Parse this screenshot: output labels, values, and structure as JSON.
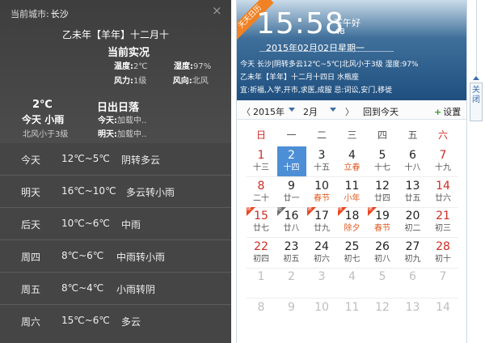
{
  "weather": {
    "city_label": "当前城市:",
    "city_name": "长沙",
    "close_icon": "×",
    "lunar_date": "乙未年【羊年】十二月十",
    "current": {
      "title": "当前实况",
      "temp_label": "温度:",
      "temp_value": "2℃",
      "humidity_label": "湿度:",
      "humidity_value": "97%",
      "wind_label": "风力:",
      "wind_value": "1级",
      "dir_label": "风向:",
      "dir_value": "北风"
    },
    "today": {
      "temp": "2℃",
      "day": "今天",
      "cond": "小雨",
      "wind": "北风小于3级"
    },
    "sun": {
      "title": "日出日落",
      "today_label": "今天:",
      "today_value": "加载中..",
      "tomorrow_label": "明天:",
      "tomorrow_value": "加载中.."
    },
    "forecast": [
      {
        "day": "今天",
        "temp": "12℃~5℃",
        "cond": "阴转多云"
      },
      {
        "day": "明天",
        "temp": "16℃~10℃",
        "cond": "多云转小雨"
      },
      {
        "day": "后天",
        "temp": "10℃~6℃",
        "cond": "中雨"
      },
      {
        "day": "周四",
        "temp": "8℃~6℃",
        "cond": "中雨转小雨"
      },
      {
        "day": "周五",
        "temp": "8℃~4℃",
        "cond": "小雨转阴"
      },
      {
        "day": "周六",
        "temp": "15℃~6℃",
        "cond": "多云"
      }
    ]
  },
  "calendar": {
    "ribbon": "天天日历",
    "clock": "15:58",
    "ampm": "下午好",
    "seconds": "48",
    "date_line": "2015年02月02日星期一",
    "weather_line": "今天 长沙|阴转多云12℃~5℃|北风小于3级 湿度:97%",
    "lunar_line": "乙未年【羊年】十二月十四日 水瓶座",
    "yiji_line": "宜:祈福,入学,开市,求医,成服 忌:词讼,安门,移徙",
    "toolbar": {
      "prev": "〈",
      "year": "2015年",
      "month": "2月",
      "next": "〉",
      "today": "回到今天",
      "settings_icon": "+",
      "settings": "设置"
    },
    "weekdays": [
      "日",
      "一",
      "二",
      "三",
      "四",
      "五",
      "六"
    ],
    "days": [
      {
        "n": "1",
        "s": "十三",
        "w": true
      },
      {
        "n": "2",
        "s": "十四",
        "sel": true
      },
      {
        "n": "3",
        "s": "十五"
      },
      {
        "n": "4",
        "s": "立春",
        "f": true
      },
      {
        "n": "5",
        "s": "十七"
      },
      {
        "n": "6",
        "s": "十八"
      },
      {
        "n": "7",
        "s": "十九",
        "w": true
      },
      {
        "n": "8",
        "s": "二十",
        "w": true
      },
      {
        "n": "9",
        "s": "廿一"
      },
      {
        "n": "10",
        "s": "春节",
        "f": true
      },
      {
        "n": "11",
        "s": "小年",
        "f": true
      },
      {
        "n": "12",
        "s": "廿四"
      },
      {
        "n": "13",
        "s": "廿五"
      },
      {
        "n": "14",
        "s": "廿六",
        "w": true
      },
      {
        "n": "15",
        "s": "廿七",
        "w": true,
        "tag": "休"
      },
      {
        "n": "16",
        "s": "廿八",
        "tag": "班",
        "ban": true
      },
      {
        "n": "17",
        "s": "廿九",
        "tag": "休"
      },
      {
        "n": "18",
        "s": "除夕",
        "f": true,
        "tag": "休"
      },
      {
        "n": "19",
        "s": "春节",
        "f": true,
        "tag": "休"
      },
      {
        "n": "20",
        "s": "初二"
      },
      {
        "n": "21",
        "s": "初三",
        "w": true
      },
      {
        "n": "22",
        "s": "初四",
        "w": true
      },
      {
        "n": "23",
        "s": "初五"
      },
      {
        "n": "24",
        "s": "初六"
      },
      {
        "n": "25",
        "s": "初七"
      },
      {
        "n": "26",
        "s": "初八"
      },
      {
        "n": "27",
        "s": "初九"
      },
      {
        "n": "28",
        "s": "初十",
        "w": true
      },
      {
        "n": "1",
        "s": "",
        "o": true
      },
      {
        "n": "2",
        "s": "",
        "o": true
      },
      {
        "n": "3",
        "s": "",
        "o": true
      },
      {
        "n": "4",
        "s": "",
        "o": true
      },
      {
        "n": "5",
        "s": "",
        "o": true
      },
      {
        "n": "6",
        "s": "",
        "o": true
      },
      {
        "n": "7",
        "s": "",
        "o": true
      },
      {
        "n": "8",
        "s": "",
        "o": true
      },
      {
        "n": "9",
        "s": "",
        "o": true
      },
      {
        "n": "10",
        "s": "",
        "o": true
      },
      {
        "n": "11",
        "s": "",
        "o": true
      },
      {
        "n": "12",
        "s": "",
        "o": true
      },
      {
        "n": "13",
        "s": "",
        "o": true
      },
      {
        "n": "14",
        "s": "",
        "o": true
      }
    ]
  },
  "side_tab": {
    "label": "关闭"
  }
}
